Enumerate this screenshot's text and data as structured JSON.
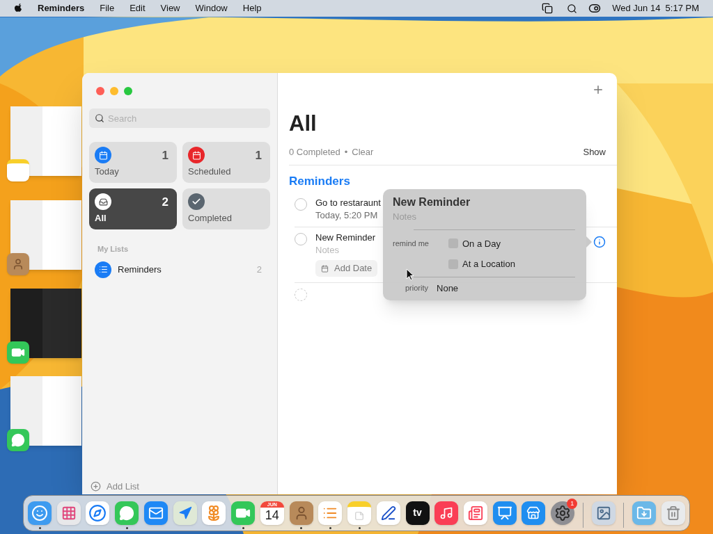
{
  "menubar": {
    "app": "Reminders",
    "menus": [
      "File",
      "Edit",
      "View",
      "Window",
      "Help"
    ],
    "clock": "Wed Jun 14  5:17 PM"
  },
  "stage_windows": [
    {
      "kind": "notes"
    },
    {
      "kind": "contacts"
    },
    {
      "kind": "facetime"
    },
    {
      "kind": "messages"
    }
  ],
  "sidebar": {
    "search": {
      "placeholder": "Search"
    },
    "smart_lists": [
      {
        "label": "Today",
        "count": "1",
        "kind": "today",
        "selected": false
      },
      {
        "label": "Scheduled",
        "count": "1",
        "kind": "scheduled",
        "selected": false
      },
      {
        "label": "All",
        "count": "2",
        "kind": "all",
        "selected": true
      },
      {
        "label": "Completed",
        "kind": "completed",
        "selected": false
      }
    ],
    "section": "My Lists",
    "lists": [
      {
        "name": "Reminders",
        "count": "2",
        "color": "#1a7cf5"
      }
    ],
    "add_list": "Add List"
  },
  "main": {
    "title": "All",
    "completed": "0 Completed",
    "separator": "•",
    "clear": "Clear",
    "show": "Show",
    "group": "Reminders",
    "items": [
      {
        "kind": "dated",
        "title": "Go to restaraunt",
        "subtitle": "Today, 5:20 PM"
      },
      {
        "kind": "editing",
        "title": "New Reminder",
        "subtitle": "Notes",
        "button": "Add Date"
      },
      {
        "kind": "empty"
      }
    ]
  },
  "popover": {
    "title": "New Reminder",
    "notes": "Notes",
    "remind_label": "remind me",
    "options": [
      {
        "label": "On a Day",
        "checked": false
      },
      {
        "label": "At a Location",
        "checked": false
      }
    ],
    "priority_label": "priority",
    "priority": "None"
  },
  "dock": [
    {
      "kind": "finder",
      "running": true
    },
    {
      "kind": "launchpad",
      "running": false
    },
    {
      "kind": "safari",
      "running": false
    },
    {
      "kind": "messages",
      "running": true
    },
    {
      "kind": "mail",
      "running": false
    },
    {
      "kind": "maps",
      "running": false
    },
    {
      "kind": "photos",
      "running": false
    },
    {
      "kind": "facetime",
      "running": true
    },
    {
      "kind": "calendar",
      "running": false,
      "month": "JUN",
      "day": "14"
    },
    {
      "kind": "contacts",
      "running": true
    },
    {
      "kind": "reminders",
      "running": true
    },
    {
      "kind": "notes",
      "running": true
    },
    {
      "kind": "freeform",
      "running": false
    },
    {
      "kind": "tv",
      "running": false,
      "label": "tv"
    },
    {
      "kind": "music",
      "running": false
    },
    {
      "kind": "news",
      "running": false
    },
    {
      "kind": "keynote",
      "running": false
    },
    {
      "kind": "appstore",
      "running": false
    },
    {
      "kind": "settings",
      "running": false,
      "badge": "1"
    },
    {
      "kind": "separator"
    },
    {
      "kind": "preview",
      "running": false
    },
    {
      "kind": "separator"
    },
    {
      "kind": "downloads",
      "running": false
    },
    {
      "kind": "trash",
      "running": false
    }
  ]
}
